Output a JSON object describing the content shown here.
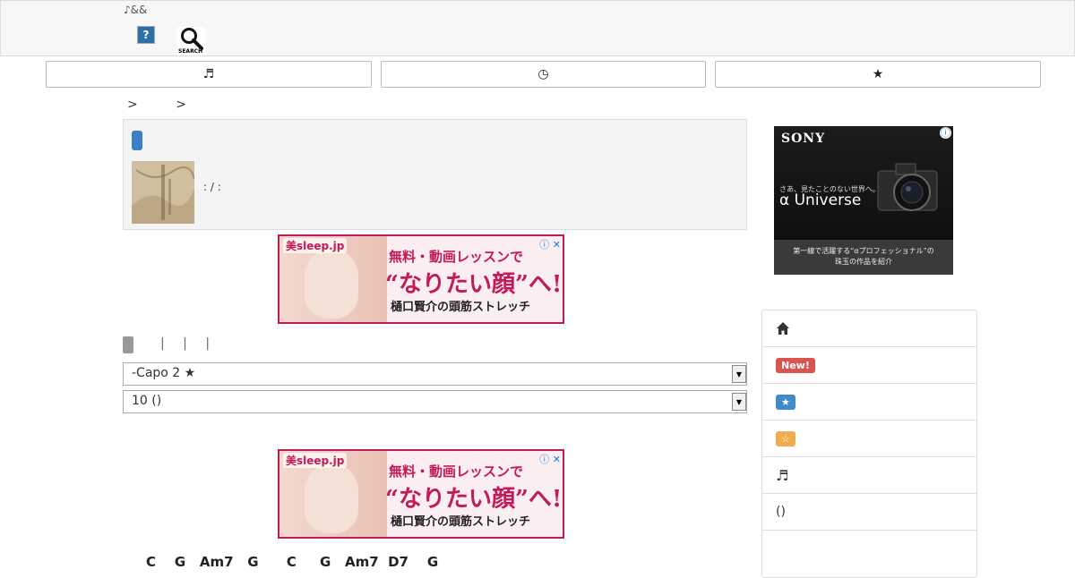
{
  "header": {
    "logo_text": "♪&&",
    "help_label": "?",
    "search_label": "SEARCH"
  },
  "nav": {
    "tabs": [
      {
        "icon": "music-note-icon",
        "glyph": "♬"
      },
      {
        "icon": "clock-icon",
        "glyph": "◷"
      },
      {
        "icon": "star-icon",
        "glyph": "★"
      }
    ]
  },
  "breadcrumb": {
    "separators": [
      ">",
      ">"
    ]
  },
  "song_info": {
    "meta_text": ": / :"
  },
  "ad_banner": {
    "brand": "美sleep.jp",
    "line1": "無料・動画レッスンで",
    "line2": "“なりたい顔”へ!",
    "line3": "樋口賢介の頭筋ストレッチ",
    "controls": "ⓘ ✕"
  },
  "controls": {
    "pipes": "| | |",
    "capo_select_value": "-Capo 2 ★",
    "size_select_value": "10 ()"
  },
  "chords_line": "C    G   Am7   G      C     G   Am7  D7    G",
  "sony_ad": {
    "brand": "SONY",
    "info": "ⓘ",
    "tagline": "さあ、見たことのない世界へ。",
    "product": "α Universe",
    "footer": "第一線で活躍する“αプロフェッショナル”の\n珠玉の作品を紹介"
  },
  "side_menu": {
    "items": [
      {
        "type": "icon",
        "icon": "home-icon",
        "glyph": "⌂"
      },
      {
        "type": "pill",
        "label": "New!",
        "color": "#d9534f"
      },
      {
        "type": "pill",
        "label": "★",
        "color": "#428bca"
      },
      {
        "type": "pill",
        "label": "☆",
        "color": "#f0ad4e"
      },
      {
        "type": "icon",
        "icon": "music-note-icon",
        "glyph": "♬"
      },
      {
        "type": "text",
        "label": "()"
      }
    ]
  }
}
